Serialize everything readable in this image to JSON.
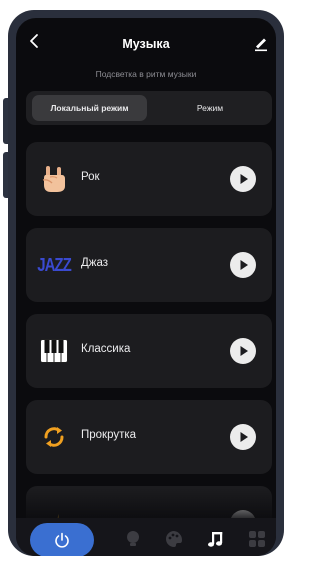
{
  "header": {
    "title": "Музыка"
  },
  "subtitle": "Подсветка в ритм музыки",
  "mode_tabs": [
    {
      "label": "Локальный режим",
      "active": true
    },
    {
      "label": "Режим",
      "active": false
    }
  ],
  "music_modes": [
    {
      "label": "Рок",
      "icon": "rock-hand-icon"
    },
    {
      "label": "",
      "icon": "jazz-icon",
      "icon_text": "JAZZ"
    },
    {
      "label": "Классика",
      "icon": "piano-icon"
    },
    {
      "label": "Прокрутка",
      "icon": "rotate-arrows-icon"
    },
    {
      "label": "",
      "icon": "partial-icon"
    }
  ],
  "labels": {
    "jazz": "Джаз"
  },
  "bottom_nav": [
    {
      "name": "power-icon",
      "active": false
    },
    {
      "name": "bulb-icon",
      "active": false
    },
    {
      "name": "palette-icon",
      "active": false
    },
    {
      "name": "music-note-icon",
      "active": true
    },
    {
      "name": "grid-icon",
      "active": false
    }
  ],
  "colors": {
    "background": "#0b0b0e",
    "card": "#1c1c1f",
    "accent": "#3a6fd1",
    "jazz_blue": "#3a4ad0",
    "orange": "#f0a020"
  }
}
